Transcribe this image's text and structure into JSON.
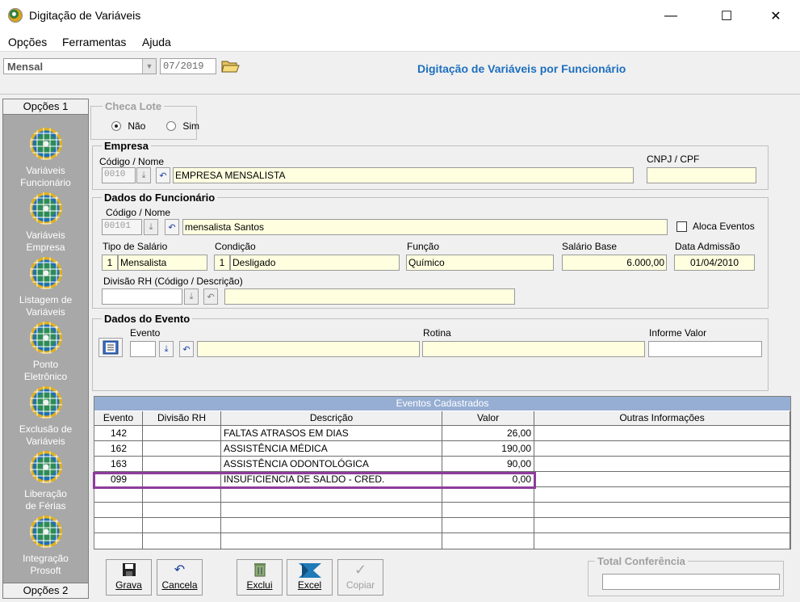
{
  "window": {
    "title": "Digitação de Variáveis",
    "minimize": "—",
    "maximize": "☐",
    "close": "✕"
  },
  "menu": [
    {
      "label": "Opções"
    },
    {
      "label": "Ferramentas"
    },
    {
      "label": "Ajuda"
    }
  ],
  "toolbar": {
    "period_type": "Mensal",
    "period": "07/2019"
  },
  "header_title": "Digitação de Variáveis por Funcionário",
  "sidebar": {
    "tab_top": "Opções 1",
    "tab_bottom": "Opções 2",
    "items": [
      {
        "line1": "Variáveis",
        "line2": "Funcionário"
      },
      {
        "line1": "Variáveis",
        "line2": "Empresa"
      },
      {
        "line1": "Listagem de",
        "line2": "Variáveis"
      },
      {
        "line1": "Ponto",
        "line2": "Eletrônico"
      },
      {
        "line1": "Exclusão de",
        "line2": "Variáveis"
      },
      {
        "line1": "Liberação",
        "line2": "de Férias"
      },
      {
        "line1": "Integração",
        "line2": "Prosoft"
      }
    ]
  },
  "checa_lote": {
    "title": "Checa Lote",
    "option_no": "Não",
    "option_yes": "Sim",
    "selected": "Não"
  },
  "empresa": {
    "title": "Empresa",
    "code_label": "Código / Nome",
    "code": "0010",
    "name": "EMPRESA MENSALISTA",
    "cnpj_label": "CNPJ / CPF",
    "cnpj": ""
  },
  "funcionario": {
    "title": "Dados do Funcionário",
    "code_label": "Código / Nome",
    "code": "00101",
    "name": "mensalista Santos",
    "aloca_label": "Aloca Eventos",
    "tipo_salario_label": "Tipo de Salário",
    "tipo_salario_code": "1",
    "tipo_salario": "Mensalista",
    "condicao_label": "Condição",
    "condicao_code": "1",
    "condicao": "Desligado",
    "funcao_label": "Função",
    "funcao": "Químico",
    "salario_label": "Salário Base",
    "salario": "6.000,00",
    "admissao_label": "Data Admissão",
    "admissao": "01/04/2010",
    "divisao_label": "Divisão RH (Código / Descrição)"
  },
  "evento": {
    "title": "Dados do Evento",
    "evento_label": "Evento",
    "rotina_label": "Rotina",
    "informe_label": "Informe Valor"
  },
  "grid": {
    "caption": "Eventos Cadastrados",
    "columns": [
      "Evento",
      "Divisão RH",
      "Descrição",
      "Valor",
      "Outras Informações"
    ],
    "rows": [
      {
        "evento": "142",
        "divisao": "",
        "descricao": "FALTAS ATRASOS EM DIAS",
        "valor": "26,00",
        "outras": ""
      },
      {
        "evento": "162",
        "divisao": "",
        "descricao": "ASSISTÊNCIA MÉDICA",
        "valor": "190,00",
        "outras": ""
      },
      {
        "evento": "163",
        "divisao": "",
        "descricao": "ASSISTÊNCIA ODONTOLÓGICA",
        "valor": "90,00",
        "outras": ""
      },
      {
        "evento": "099",
        "divisao": "",
        "descricao": "INSUFICIENCIA DE SALDO - CRED.",
        "valor": "0,00",
        "outras": ""
      }
    ]
  },
  "buttons": {
    "grava": "Grava",
    "cancela": "Cancela",
    "exclui": "Exclui",
    "excel": "Excel",
    "copiar": "Copiar"
  },
  "total": {
    "title": "Total Conferência",
    "value": ""
  },
  "colors": {
    "accent_title": "#1d6fbf",
    "grid_caption": "#96aed3",
    "highlight": "#8e3c9c",
    "field_bg": "#ffffe0"
  }
}
